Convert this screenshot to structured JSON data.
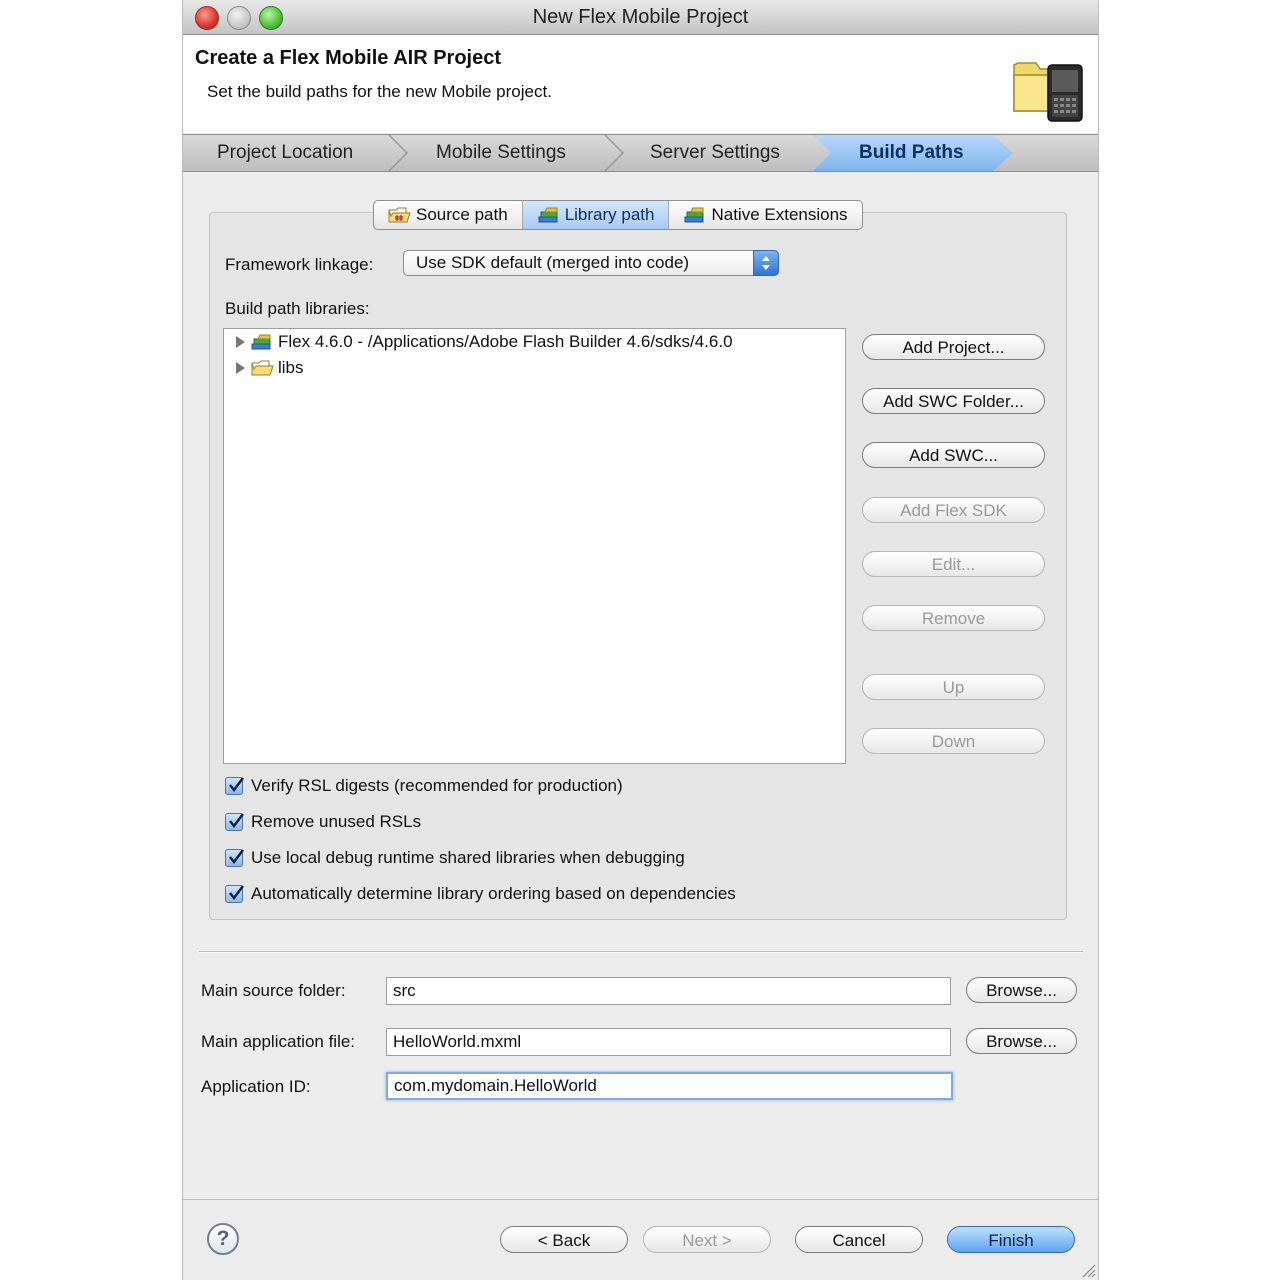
{
  "window": {
    "title": "New Flex Mobile Project"
  },
  "header": {
    "title": "Create a Flex Mobile AIR Project",
    "subtitle": "Set the build paths for the new Mobile project."
  },
  "steps": [
    {
      "label": "Project Location",
      "active": false
    },
    {
      "label": "Mobile Settings",
      "active": false
    },
    {
      "label": "Server Settings",
      "active": false
    },
    {
      "label": "Build Paths",
      "active": true
    }
  ],
  "tabs": [
    {
      "label": "Source path",
      "icon": "source-folder-icon",
      "active": false
    },
    {
      "label": "Library path",
      "icon": "library-books-icon",
      "active": true
    },
    {
      "label": "Native Extensions",
      "icon": "native-ext-icon",
      "active": false
    }
  ],
  "framework_linkage": {
    "label": "Framework linkage:",
    "value": "Use SDK default (merged into code)"
  },
  "build_path": {
    "label": "Build path libraries:",
    "items": [
      {
        "label": "Flex 4.6.0 - /Applications/Adobe Flash Builder 4.6/sdks/4.6.0",
        "icon": "sdk-library-icon"
      },
      {
        "label": "libs",
        "icon": "folder-icon"
      }
    ]
  },
  "side_buttons": {
    "add_project": "Add Project...",
    "add_swc_folder": "Add SWC Folder...",
    "add_swc": "Add SWC...",
    "add_flex_sdk": "Add Flex SDK",
    "edit": "Edit...",
    "remove": "Remove",
    "up": "Up",
    "down": "Down"
  },
  "checkboxes": [
    {
      "label": "Verify RSL digests (recommended for production)",
      "checked": true
    },
    {
      "label": "Remove unused RSLs",
      "checked": true
    },
    {
      "label": "Use local debug runtime shared libraries when debugging",
      "checked": true
    },
    {
      "label": "Automatically determine library ordering based on dependencies",
      "checked": true
    }
  ],
  "form": {
    "main_source_folder": {
      "label": "Main source folder:",
      "value": "src"
    },
    "main_application_file": {
      "label": "Main application file:",
      "value": "HelloWorld.mxml"
    },
    "application_id": {
      "label": "Application ID:",
      "value": "com.mydomain.HelloWorld"
    },
    "browse_label": "Browse..."
  },
  "footer": {
    "help": "?",
    "back": "< Back",
    "next": "Next >",
    "cancel": "Cancel",
    "finish": "Finish"
  },
  "colors": {
    "accent": "#5ea6ef",
    "active_step": "#8fc0f4",
    "window_bg": "#ececec"
  }
}
